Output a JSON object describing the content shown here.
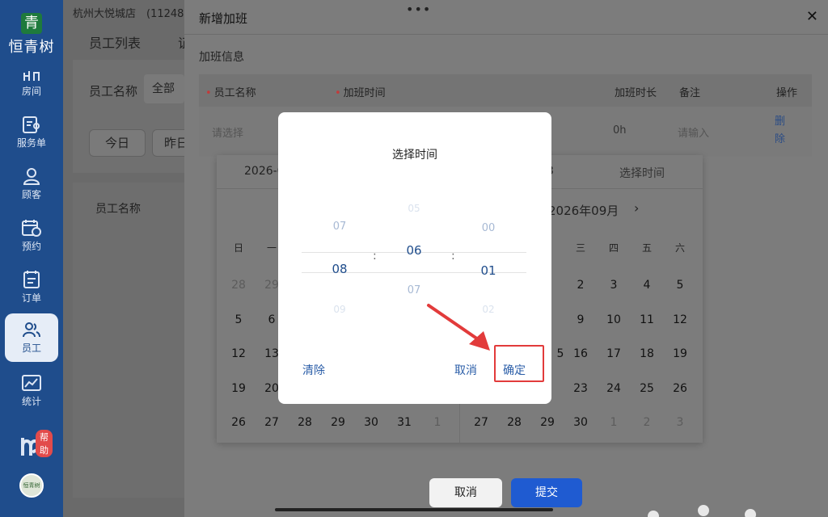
{
  "sidebar": {
    "logo_mark": "青",
    "logo_name": "恒青树",
    "items": [
      {
        "label": "房间"
      },
      {
        "label": "服务单"
      },
      {
        "label": "顾客"
      },
      {
        "label": "预约"
      },
      {
        "label": "订单"
      },
      {
        "label": "员工"
      },
      {
        "label": "统计"
      }
    ],
    "help_badge": "帮助",
    "avatar_text": "恒青树"
  },
  "background_page": {
    "store_name": "杭州大悦城店　(11248",
    "tab_employees": "员工列表",
    "tab_clipped": "证",
    "filter_label": "员工名称",
    "filter_value": "全部",
    "btn_today": "今日",
    "btn_yesterday": "昨日",
    "list_header": "员工名称"
  },
  "drawer": {
    "title": "新增加班",
    "close_glyph": "✕",
    "section_title": "加班信息",
    "columns": {
      "employee": "员工名称",
      "time": "加班时间",
      "duration": "加班时长",
      "note": "备注",
      "action": "操作"
    },
    "row": {
      "employee_placeholder": "请选择",
      "duration": "0h",
      "note_placeholder": "请输入",
      "delete_1": "删",
      "delete_2": "除"
    },
    "cancel": "取消",
    "submit": "提交"
  },
  "calendar": {
    "date_text": "2026-0",
    "time_text": "3",
    "select_time": "选择时间",
    "month": "2026年09月",
    "next_glyph": "›",
    "weekdays_left": [
      "日",
      "一"
    ],
    "weekdays_right": [
      "三",
      "四",
      "五",
      "六"
    ],
    "left_rows": [
      [
        "28",
        "29"
      ],
      [
        "5",
        "6"
      ],
      [
        "12",
        "13"
      ],
      [
        "19",
        "20"
      ],
      [
        "26",
        "27",
        "28",
        "29",
        "30",
        "31",
        "1"
      ]
    ],
    "right_rows": [
      [
        "2",
        "3",
        "4",
        "5"
      ],
      [
        "9",
        "10",
        "11",
        "12"
      ],
      [
        "16",
        "17",
        "18",
        "19"
      ],
      [
        "23",
        "24",
        "25",
        "26"
      ],
      [
        "27",
        "28",
        "29",
        "30",
        "1",
        "2",
        "3"
      ]
    ],
    "partial_15": "5"
  },
  "time_picker": {
    "title": "选择时间",
    "hours": {
      "prev": "07",
      "selected": "08",
      "next": "09"
    },
    "minutes": {
      "prev2": "05",
      "selected": "06",
      "next": "07"
    },
    "seconds": {
      "prev": "00",
      "selected": "01",
      "next": "02"
    },
    "separator": ":",
    "clear": "清除",
    "cancel": "取消",
    "confirm": "确定"
  },
  "colors": {
    "sidebar": "#1f4d8c",
    "primary": "#1f5bd1",
    "highlight": "#e23b3b"
  }
}
